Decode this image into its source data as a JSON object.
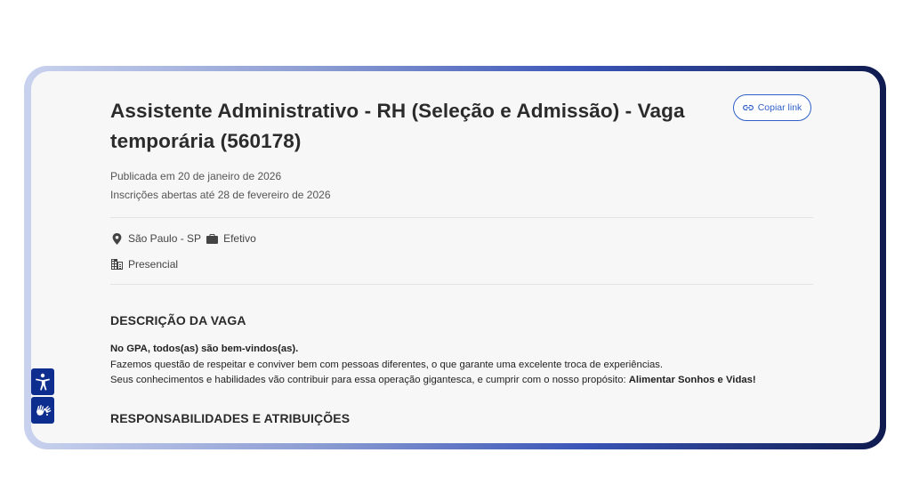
{
  "job": {
    "title": "Assistente Administrativo - RH (Seleção e Admissão) - Vaga temporária (560178)",
    "published": "Publicada em 20 de janeiro de 2026",
    "open_until": "Inscrições abertas até 28 de fevereiro de 2026",
    "location": "São Paulo - SP",
    "contract": "Efetivo",
    "work_mode": "Presencial"
  },
  "actions": {
    "copy_link_label": "Copiar link"
  },
  "description": {
    "heading": "DESCRIÇÃO DA VAGA",
    "line1": "No GPA, todos(as) são bem-vindos(as).",
    "line2": "Fazemos questão de respeitar e conviver bem com pessoas diferentes, o que garante uma excelente troca de experiências.",
    "line3_text": "Seus conhecimentos e habilidades vão contribuir para essa operação gigantesca, e cumprir com o nosso propósito: ",
    "line3_bold": "Alimentar Sonhos e Vidas!"
  },
  "responsibilities": {
    "heading": "RESPONSABILIDADES E ATRIBUIÇÕES"
  },
  "icons": {
    "location": "location-pin-icon",
    "contract": "briefcase-icon",
    "work_mode": "building-icon",
    "copy": "link-icon",
    "accessibility": "accessibility-icon",
    "sign_language": "sign-language-icon"
  },
  "colors": {
    "accent": "#2f5fc7",
    "a11y_bg": "#0d2d8f",
    "card_bg": "#f7f7f8"
  }
}
